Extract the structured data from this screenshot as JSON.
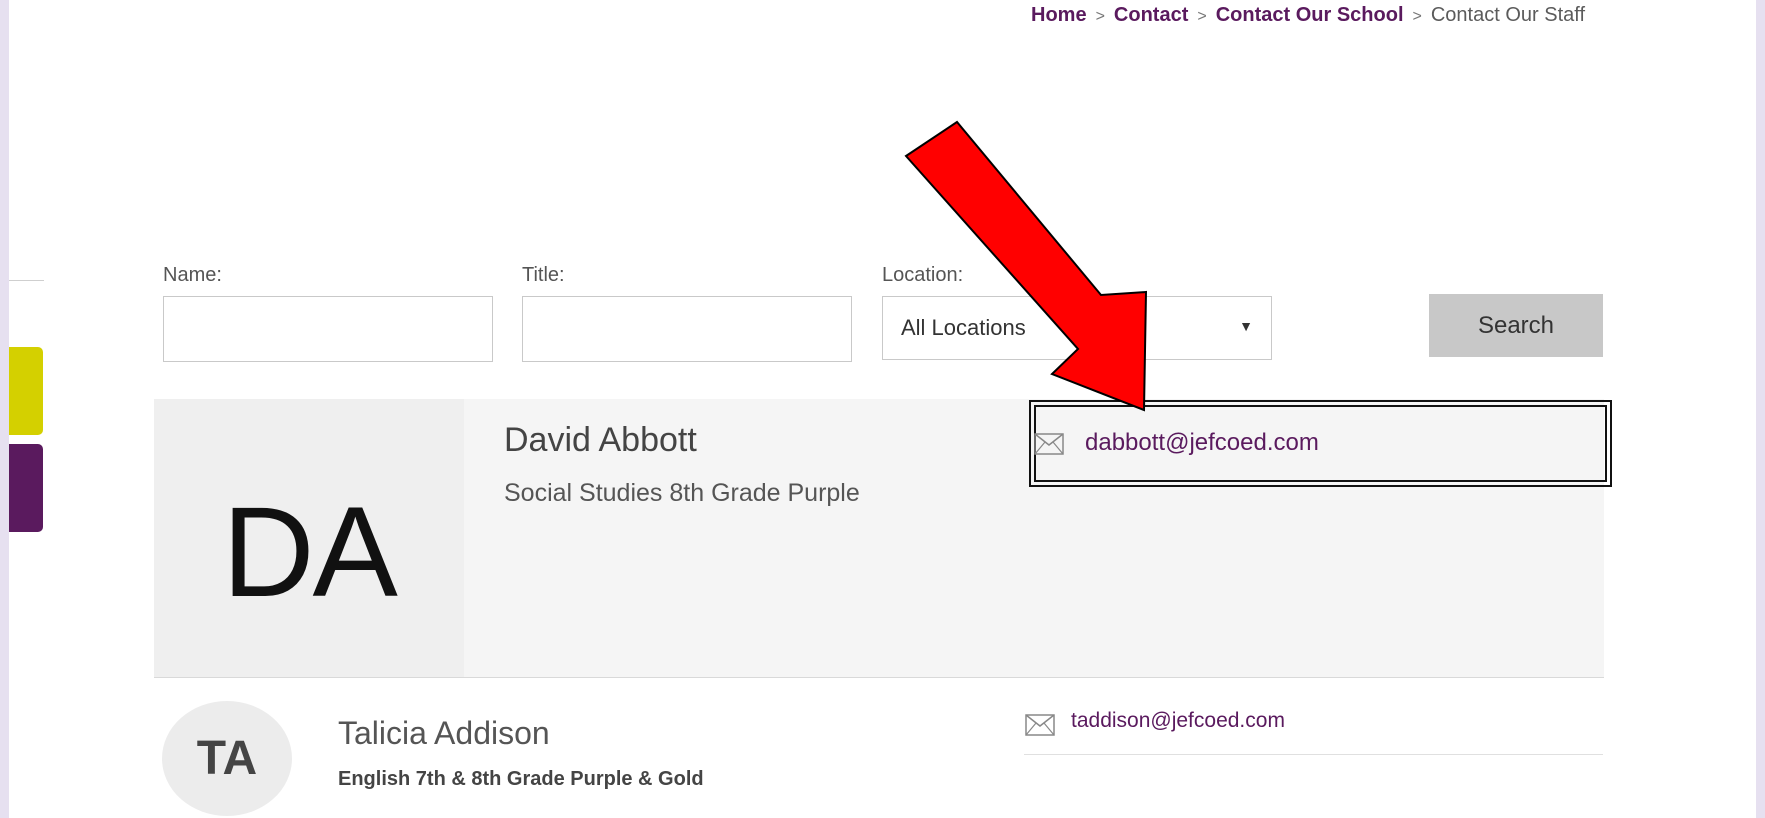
{
  "breadcrumb": {
    "home": "Home",
    "contact": "Contact",
    "school": "Contact Our School",
    "current": "Contact Our Staff",
    "separator": ">"
  },
  "filters": {
    "name_label": "Name:",
    "title_label": "Title:",
    "location_label": "Location:",
    "location_value": "All Locations",
    "search_label": "Search"
  },
  "staff": [
    {
      "initials": "DA",
      "name": "David Abbott",
      "title": "Social Studies 8th Grade Purple",
      "email": "dabbott@jefcoed.com"
    },
    {
      "initials": "TA",
      "name": "Talicia Addison",
      "title": "English 7th & 8th Grade Purple & Gold",
      "email": "taddison@jefcoed.com"
    }
  ],
  "colors": {
    "brand_purple": "#5a1a5e",
    "brand_gold": "#d4d000",
    "annotation_red": "#ff0000"
  },
  "icons": {
    "email": "envelope-icon",
    "select": "caret-down-icon"
  }
}
